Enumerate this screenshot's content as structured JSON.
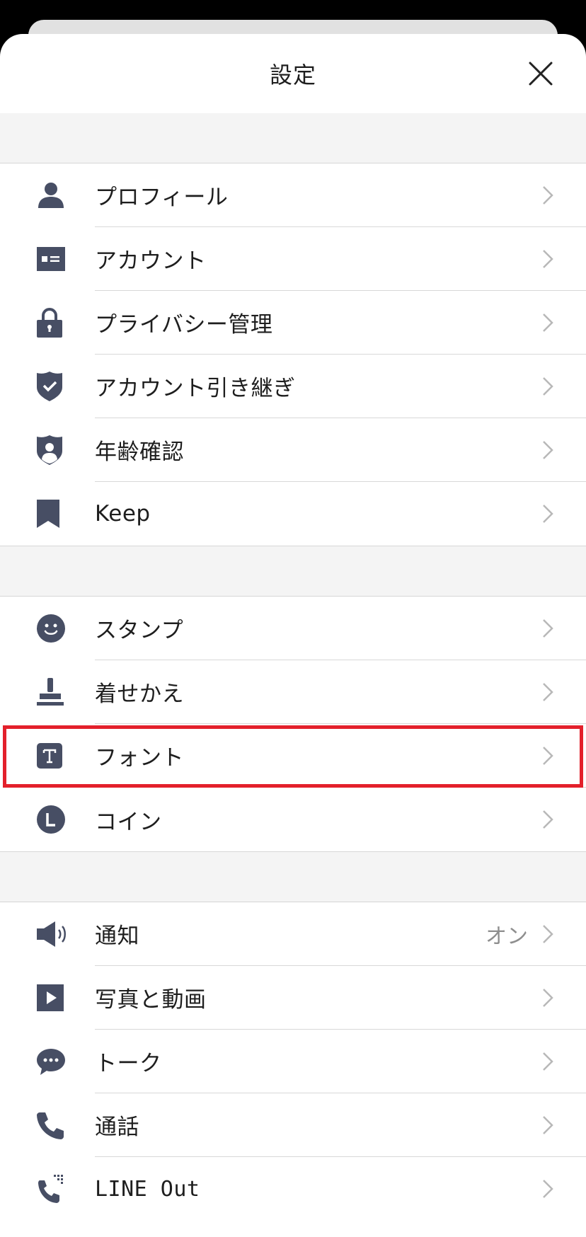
{
  "header": {
    "title": "設定"
  },
  "sections": [
    {
      "items": [
        {
          "id": "profile",
          "label": "プロフィール",
          "icon": "person-icon"
        },
        {
          "id": "account",
          "label": "アカウント",
          "icon": "id-card-icon"
        },
        {
          "id": "privacy",
          "label": "プライバシー管理",
          "icon": "lock-icon"
        },
        {
          "id": "account-transfer",
          "label": "アカウント引き継ぎ",
          "icon": "shield-check-icon"
        },
        {
          "id": "age-verification",
          "label": "年齢確認",
          "icon": "shield-person-icon"
        },
        {
          "id": "keep",
          "label": "Keep",
          "icon": "bookmark-icon"
        }
      ]
    },
    {
      "items": [
        {
          "id": "stickers",
          "label": "スタンプ",
          "icon": "smiley-icon"
        },
        {
          "id": "themes",
          "label": "着せかえ",
          "icon": "brush-icon"
        },
        {
          "id": "fonts",
          "label": "フォント",
          "icon": "font-icon",
          "highlighted": true
        },
        {
          "id": "coins",
          "label": "コイン",
          "icon": "coin-icon"
        }
      ]
    },
    {
      "items": [
        {
          "id": "notifications",
          "label": "通知",
          "value": "オン",
          "icon": "speaker-icon"
        },
        {
          "id": "photos-videos",
          "label": "写真と動画",
          "icon": "play-icon"
        },
        {
          "id": "chats",
          "label": "トーク",
          "icon": "chat-bubble-icon"
        },
        {
          "id": "calls",
          "label": "通話",
          "icon": "phone-icon"
        },
        {
          "id": "line-out",
          "label": "LINE Out",
          "icon": "phone-out-icon"
        }
      ]
    }
  ],
  "colors": {
    "icon": "#474e64",
    "highlight": "#e3202b",
    "chevron": "#b8b8b8",
    "value_text": "#8e8e8e"
  }
}
